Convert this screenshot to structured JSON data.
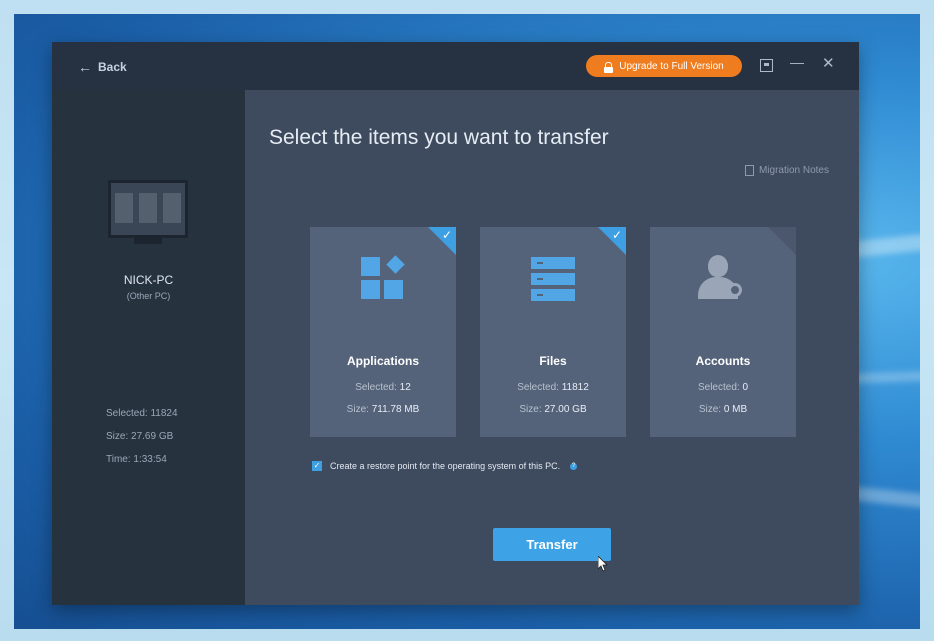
{
  "header": {
    "back_label": "Back",
    "upgrade_label": "Upgrade to Full Version"
  },
  "sidebar": {
    "pc_name": "NICK-PC",
    "pc_type": "(Other PC)",
    "selected": "Selected:  11824",
    "size": "Size:  27.69 GB",
    "time": "Time:  1:33:54"
  },
  "main": {
    "title": "Select the items you want to transfer",
    "migration_notes": "Migration Notes",
    "cards": [
      {
        "title": "Applications",
        "selected_label": "Selected:",
        "selected_value": "12",
        "size_label": "Size:",
        "size_value": "711.78 MB",
        "checked": true,
        "icon": "apps-icon"
      },
      {
        "title": "Files",
        "selected_label": "Selected:",
        "selected_value": "11812",
        "size_label": "Size:",
        "size_value": "27.00 GB",
        "checked": true,
        "icon": "server-icon"
      },
      {
        "title": "Accounts",
        "selected_label": "Selected:",
        "selected_value": "0",
        "size_label": "Size:",
        "size_value": "0 MB",
        "checked": false,
        "icon": "user-gear-icon"
      }
    ],
    "restore_point_label": "Create a restore point for the operating system of this PC.",
    "restore_point_checked": true,
    "transfer_label": "Transfer"
  },
  "colors": {
    "accent": "#3ea3e6",
    "upgrade": "#ef7c1e",
    "window_bg": "#3e4b5f",
    "sidebar_bg": "#27323f"
  }
}
